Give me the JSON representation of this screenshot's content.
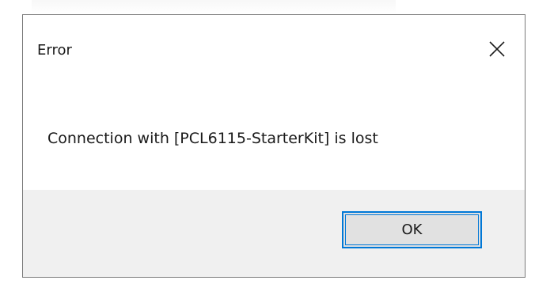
{
  "dialog": {
    "title": "Error",
    "message": "Connection with [PCL6115-StarterKit] is lost",
    "ok_label": "OK",
    "close_icon": "close-icon"
  },
  "colors": {
    "accent": "#0078d7",
    "footer_bg": "#f0f0f0",
    "button_bg": "#e1e1e1",
    "border": "#7a7a7a"
  }
}
